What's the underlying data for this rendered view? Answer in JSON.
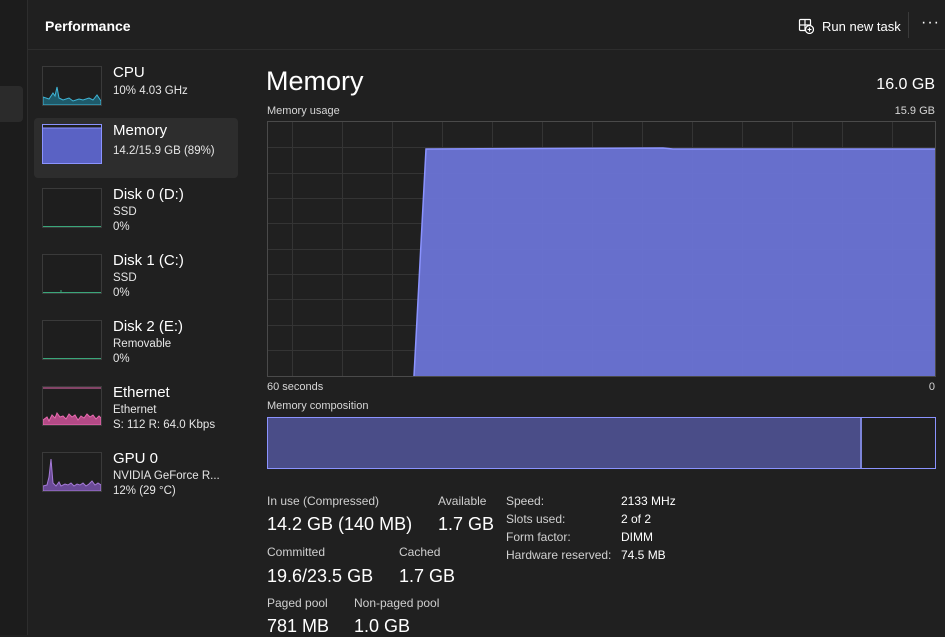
{
  "header": {
    "title": "Performance",
    "run_new_task": "Run new task",
    "more": "···"
  },
  "sidebar": {
    "items": [
      {
        "name": "CPU",
        "lines": [
          "10%  4.03 GHz"
        ],
        "selected": false
      },
      {
        "name": "Memory",
        "lines": [
          "14.2/15.9 GB (89%)"
        ],
        "selected": true
      },
      {
        "name": "Disk 0 (D:)",
        "lines": [
          "SSD",
          "0%"
        ],
        "selected": false
      },
      {
        "name": "Disk 1 (C:)",
        "lines": [
          "SSD",
          "0%"
        ],
        "selected": false
      },
      {
        "name": "Disk 2 (E:)",
        "lines": [
          "Removable",
          "0%"
        ],
        "selected": false
      },
      {
        "name": "Ethernet",
        "lines": [
          "Ethernet",
          "S: 112  R: 64.0 Kbps"
        ],
        "selected": false
      },
      {
        "name": "GPU 0",
        "lines": [
          "NVIDIA GeForce R...",
          "12%  (29 °C)"
        ],
        "selected": false
      }
    ]
  },
  "main": {
    "title": "Memory",
    "total": "16.0 GB",
    "usage_label": "Memory usage",
    "usage_max": "15.9 GB",
    "time_label": "60 seconds",
    "time_end": "0",
    "composition_label": "Memory composition",
    "composition_in_use_fraction": 0.89,
    "stats": {
      "in_use_label": "In use (Compressed)",
      "in_use_value": "14.2 GB (140 MB)",
      "available_label": "Available",
      "available_value": "1.7 GB",
      "committed_label": "Committed",
      "committed_value": "19.6/23.5 GB",
      "cached_label": "Cached",
      "cached_value": "1.7 GB",
      "paged_label": "Paged pool",
      "paged_value": "781 MB",
      "nonpaged_label": "Non-paged pool",
      "nonpaged_value": "1.0 GB"
    },
    "specs": [
      {
        "label": "Speed:",
        "value": "2133 MHz"
      },
      {
        "label": "Slots used:",
        "value": "2 of 2"
      },
      {
        "label": "Form factor:",
        "value": "DIMM"
      },
      {
        "label": "Hardware reserved:",
        "value": "74.5 MB"
      }
    ]
  },
  "colors": {
    "memory_fill": "#6b74d6",
    "memory_line": "#8b93ff",
    "cpu": "#3fb5d6",
    "ethernet": "#e86ab0",
    "gpu": "#a57ad8",
    "disk": "#3aa67a"
  }
}
